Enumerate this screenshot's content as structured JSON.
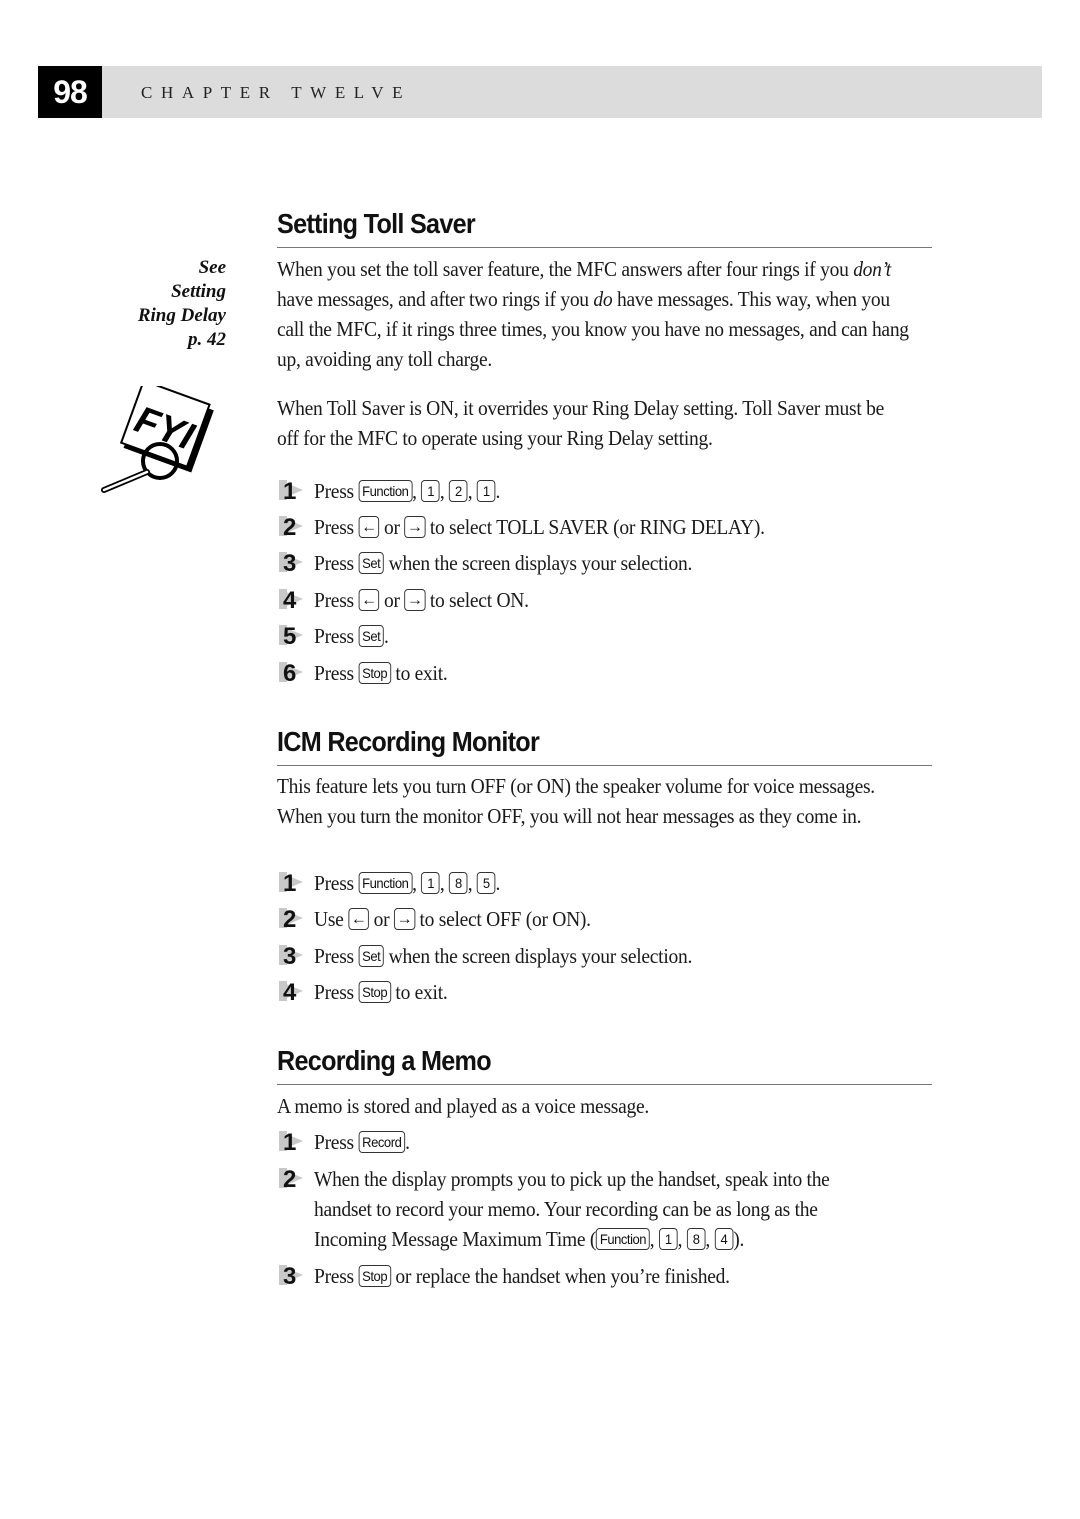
{
  "header": {
    "page_number": "98",
    "chapter": "CHAPTER TWELVE"
  },
  "side_note": {
    "line1": "See",
    "line2": "Setting",
    "line3": "Ring Delay",
    "line4": "p. 42",
    "icon": "fyi-magnifier-icon"
  },
  "sections": [
    {
      "title": "Setting Toll Saver",
      "para1": {
        "a": "When you set the toll saver feature, the MFC answers after four rings if you ",
        "b": "don’t",
        "c": " have messages, and after two rings if you ",
        "d": "do",
        "e": " have messages. This way, when you call the MFC, if it rings three times, you know you have no messages, and can hang up, avoiding any toll charge."
      },
      "para2": "When Toll Saver is ON, it overrides your Ring Delay setting. Toll Saver must be off for the MFC to operate using your Ring Delay setting.",
      "steps": [
        {
          "num": "1",
          "pre": "Press ",
          "keys": [
            "Function",
            "1",
            "2",
            "1"
          ],
          "post": "."
        },
        {
          "num": "2",
          "pre": "Press ",
          "k1": "←",
          "mid": " or ",
          "k2": "→",
          "post": " to select TOLL SAVER (or RING DELAY)."
        },
        {
          "num": "3",
          "pre": "Press ",
          "key": "Set",
          "post": " when the screen displays your selection."
        },
        {
          "num": "4",
          "pre": "Press ",
          "k1": "←",
          "mid": " or ",
          "k2": "→",
          "post": " to select ON."
        },
        {
          "num": "5",
          "pre": "Press ",
          "key": "Set",
          "post": "."
        },
        {
          "num": "6",
          "pre": "Press ",
          "key": "Stop",
          "post": " to exit."
        }
      ]
    },
    {
      "title": "ICM Recording Monitor",
      "para1": "This feature lets you turn OFF (or ON) the speaker volume for voice messages. When you turn the monitor OFF, you will not hear messages as they come in.",
      "steps": [
        {
          "num": "1",
          "pre": "Press ",
          "keys": [
            "Function",
            "1",
            "8",
            "5"
          ],
          "post": "."
        },
        {
          "num": "2",
          "pre": "Use ",
          "k1": "←",
          "mid": " or ",
          "k2": "→",
          "post": " to select OFF (or ON)."
        },
        {
          "num": "3",
          "pre": "Press ",
          "key": "Set",
          "post": " when the screen displays your selection."
        },
        {
          "num": "4",
          "pre": "Press ",
          "key": "Stop",
          "post": " to exit."
        }
      ]
    },
    {
      "title": "Recording a Memo",
      "para1": "A memo is stored and played as a voice message.",
      "steps": [
        {
          "num": "1",
          "pre": "Press ",
          "key": "Record",
          "post": "."
        },
        {
          "num": "2",
          "line1": "When the display prompts you to pick up the handset, speak into the",
          "line2": "handset to record your memo. Your recording can be as long as the",
          "line3_pre": "Incoming Message Maximum Time (",
          "keys": [
            "Function",
            "1",
            "8",
            "4"
          ],
          "line3_post": ")."
        },
        {
          "num": "3",
          "pre": "Press ",
          "key": "Stop",
          "post": " or replace the handset when you’re finished."
        }
      ]
    }
  ]
}
